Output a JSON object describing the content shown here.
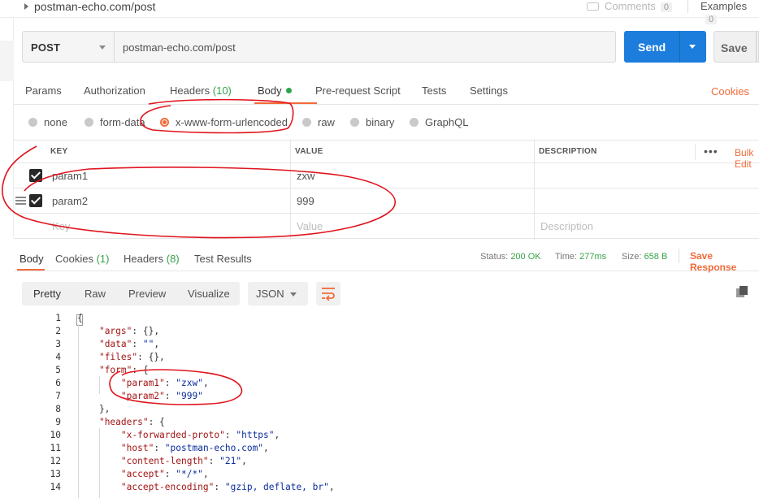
{
  "topbar": {
    "title": "postman-echo.com/post",
    "comments_label": "Comments",
    "comments_count": "0",
    "examples_label": "Examples",
    "examples_count": "0"
  },
  "request": {
    "method": "POST",
    "url": "postman-echo.com/post",
    "send_label": "Send",
    "save_label": "Save"
  },
  "request_tabs": [
    {
      "label": "Params"
    },
    {
      "label": "Authorization"
    },
    {
      "label": "Headers",
      "count": "(10)"
    },
    {
      "label": "Body"
    },
    {
      "label": "Pre-request Script"
    },
    {
      "label": "Tests"
    },
    {
      "label": "Settings"
    }
  ],
  "cookies_label": "Cookies",
  "body_types": [
    "none",
    "form-data",
    "x-www-form-urlencoded",
    "raw",
    "binary",
    "GraphQL"
  ],
  "body_type_selected": "x-www-form-urlencoded",
  "params_table": {
    "headers": [
      "KEY",
      "VALUE",
      "DESCRIPTION"
    ],
    "rows": [
      {
        "key": "param1",
        "value": "zxw",
        "description": ""
      },
      {
        "key": "param2",
        "value": "999",
        "description": ""
      }
    ],
    "placeholder": {
      "key": "Key",
      "value": "Value",
      "description": "Description"
    },
    "bulk_edit_label": "Bulk Edit"
  },
  "response_tabs": [
    {
      "label": "Body"
    },
    {
      "label": "Cookies",
      "count": "(1)"
    },
    {
      "label": "Headers",
      "count": "(8)"
    },
    {
      "label": "Test Results"
    }
  ],
  "response_status": {
    "status_label": "Status:",
    "status_value": "200 OK",
    "time_label": "Time:",
    "time_value": "277ms",
    "size_label": "Size:",
    "size_value": "658 B",
    "save_response_label": "Save Response"
  },
  "view_modes": [
    "Pretty",
    "Raw",
    "Preview",
    "Visualize"
  ],
  "format": "JSON",
  "code_lines": [
    "{",
    "    \"args\": {},",
    "    \"data\": \"\",",
    "    \"files\": {},",
    "    \"form\": {",
    "        \"param1\": \"zxw\",",
    "        \"param2\": \"999\"",
    "    },",
    "    \"headers\": {",
    "        \"x-forwarded-proto\": \"https\",",
    "        \"host\": \"postman-echo.com\",",
    "        \"content-length\": \"21\",",
    "        \"accept\": \"*/*\",",
    "        \"accept-encoding\": \"gzip, deflate, br\","
  ],
  "colors": {
    "accent": "#f26b3a",
    "send": "#1d7ddd",
    "success": "#36a14b",
    "annotation": "#e0141e"
  }
}
